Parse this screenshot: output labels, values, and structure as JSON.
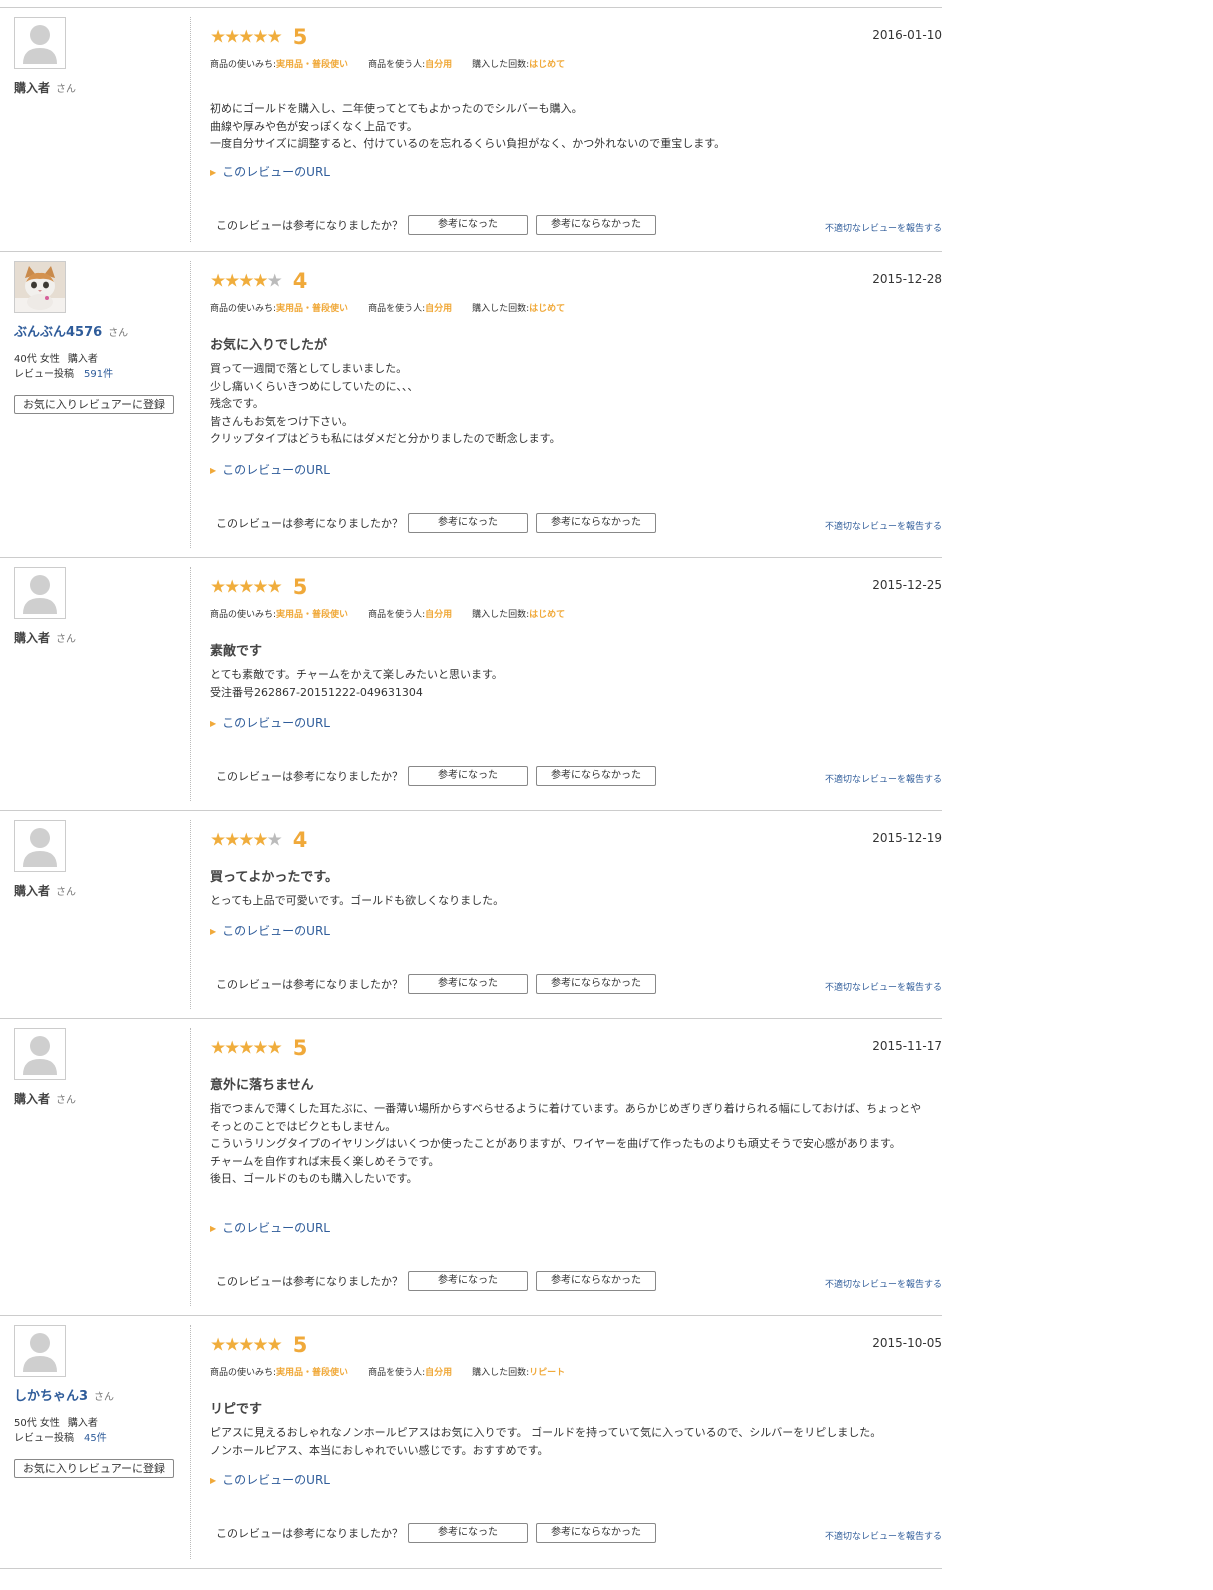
{
  "common": {
    "san": "さん",
    "url_link": "このレビューのURL",
    "helpful_question": "このレビューは参考になりましたか？",
    "helpful_yes": "参考になった",
    "helpful_no": "参考にならなかった",
    "report": "不適切なレビューを報告する",
    "fav_button": "お気に入りレビュアーに登録",
    "attr_label_usage": "商品の使いみち:",
    "attr_label_user": "商品を使う人:",
    "attr_label_times": "購入した回数:",
    "review_count_label": "レビュー投稿"
  },
  "colors": {
    "star": "#f0ad3c",
    "accent": "#f0a93a",
    "link": "#2f5c9a",
    "rule": "#cccccc"
  },
  "icons": {
    "default_avatar": "person-silhouette-icon",
    "cat_avatar": "cat-photo-avatar",
    "link_marker": "triangle-right-icon"
  },
  "reviews": [
    {
      "reviewer": "購入者",
      "rating": 5,
      "rating_text": "5",
      "date": "2016-01-10",
      "attributes": {
        "usage": "実用品・普段使い",
        "user": "自分用",
        "times": "はじめて"
      },
      "title": "",
      "body": [
        "初めにゴールドを購入し、二年使ってとてもよかったのでシルバーも購入。",
        "曲線や厚みや色が安っぽくなく上品です。",
        "一度自分サイズに調整すると、付けているのを忘れるくらい負担がなく、かつ外れないので重宝します。"
      ]
    },
    {
      "reviewer": "ぶんぶん4576",
      "rating": 4,
      "rating_text": "4",
      "date": "2015-12-28",
      "meta": {
        "age_gender": "40代 女性",
        "buyer": "購入者",
        "count": "591件"
      },
      "attributes": {
        "usage": "実用品・普段使い",
        "user": "自分用",
        "times": "はじめて"
      },
      "title": "お気に入りでしたが",
      "body": [
        "買って一週間で落としてしまいました。",
        "少し痛いくらいきつめにしていたのに、、、",
        "残念です。",
        "皆さんもお気をつけ下さい。",
        "クリップタイプはどうも私にはダメだと分かりましたので断念します。"
      ]
    },
    {
      "reviewer": "購入者",
      "rating": 5,
      "rating_text": "5",
      "date": "2015-12-25",
      "attributes": {
        "usage": "実用品・普段使い",
        "user": "自分用",
        "times": "はじめて"
      },
      "title": "素敵です",
      "body": [
        "とても素敵です。チャームをかえて楽しみたいと思います。",
        "受注番号262867-20151222-049631304"
      ]
    },
    {
      "reviewer": "購入者",
      "rating": 4,
      "rating_text": "4",
      "date": "2015-12-19",
      "title": "買ってよかったです。",
      "body": [
        "とっても上品で可愛いです。ゴールドも欲しくなりました。"
      ]
    },
    {
      "reviewer": "購入者",
      "rating": 5,
      "rating_text": "5",
      "date": "2015-11-17",
      "title": "意外に落ちません",
      "body": [
        "指でつまんで薄くした耳たぶに、一番薄い場所からすべらせるように着けています。あらかじめぎりぎり着けられる幅にしておけば、ちょっとやそっとのことではビクともしません。",
        "こういうリングタイプのイヤリングはいくつか使ったことがありますが、ワイヤーを曲げて作ったものよりも頑丈そうで安心感があります。",
        "チャームを自作すれば末長く楽しめそうです。",
        "後日、ゴールドのものも購入したいです。"
      ]
    },
    {
      "reviewer": "しかちゃん3",
      "rating": 5,
      "rating_text": "5",
      "date": "2015-10-05",
      "meta": {
        "age_gender": "50代 女性",
        "buyer": "購入者",
        "count": "45件"
      },
      "attributes": {
        "usage": "実用品・普段使い",
        "user": "自分用",
        "times": "リピート"
      },
      "title": "リピです",
      "body": [
        "ピアスに見えるおしゃれなノンホールピアスはお気に入りです。 ゴールドを持っていて気に入っているので、シルバーをリピしました。",
        "ノンホールピアス、本当におしゃれでいい感じです。おすすめです。"
      ]
    }
  ]
}
